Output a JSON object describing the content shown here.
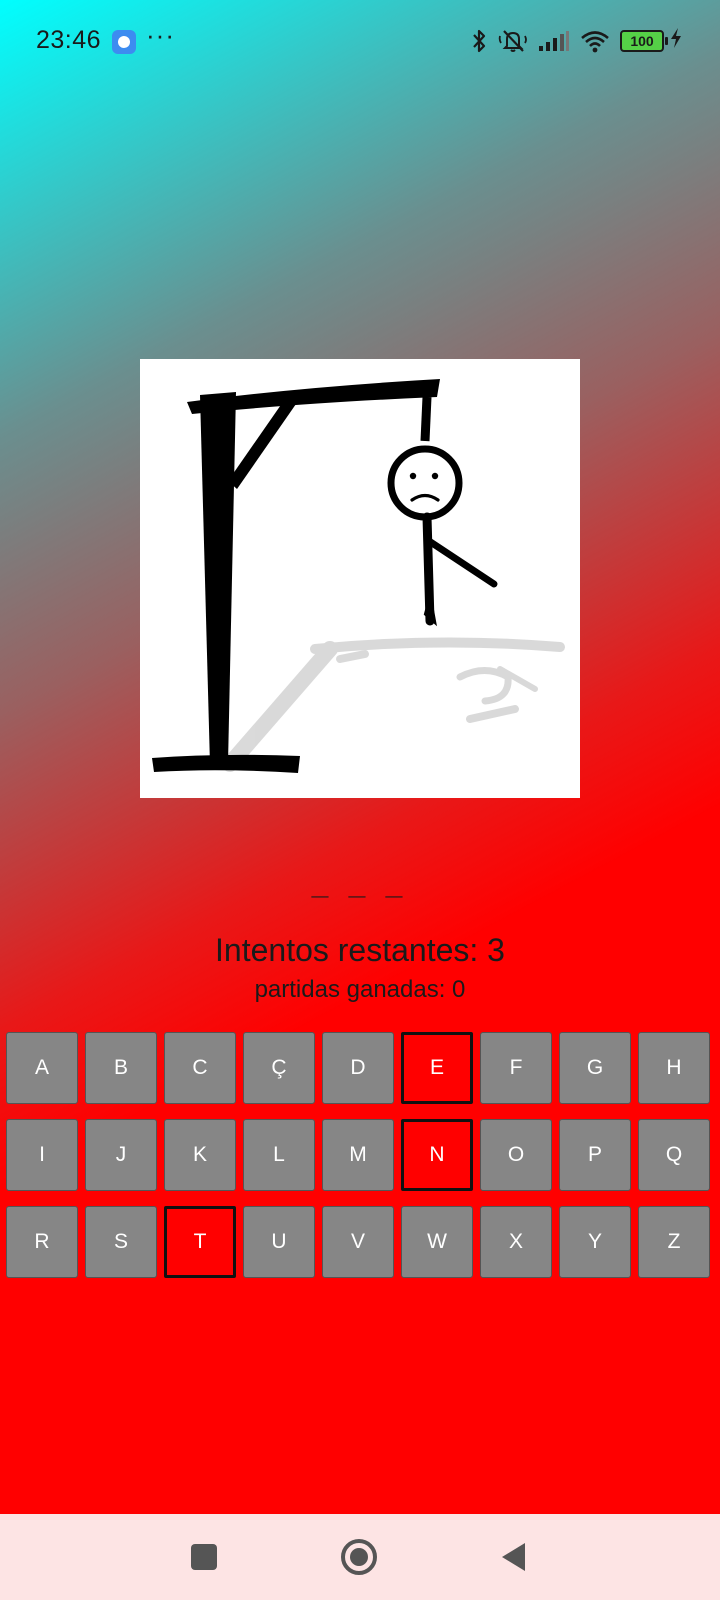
{
  "status_bar": {
    "time": "23:46",
    "more": "···",
    "battery_level": "100"
  },
  "game": {
    "word_display": "_ _ _",
    "attempts_label": "Intentos restantes: 3",
    "wins_label": "partidas ganadas: 0",
    "attempts_remaining": 3,
    "games_won": 0,
    "keyboard_rows": [
      [
        "A",
        "B",
        "C",
        "Ç",
        "D",
        "E",
        "F",
        "G",
        "H"
      ],
      [
        "I",
        "J",
        "K",
        "L",
        "M",
        "N",
        "O",
        "P",
        "Q"
      ],
      [
        "R",
        "S",
        "T",
        "U",
        "V",
        "W",
        "X",
        "Y",
        "Z"
      ]
    ],
    "used_letters": [
      "E",
      "N",
      "T"
    ]
  },
  "colors": {
    "key_default": "#868686",
    "key_used": "#ff0000",
    "nav_bar": "#fde4e4"
  },
  "nav": {
    "icons": [
      "recent-apps-icon",
      "home-icon",
      "back-icon"
    ]
  }
}
